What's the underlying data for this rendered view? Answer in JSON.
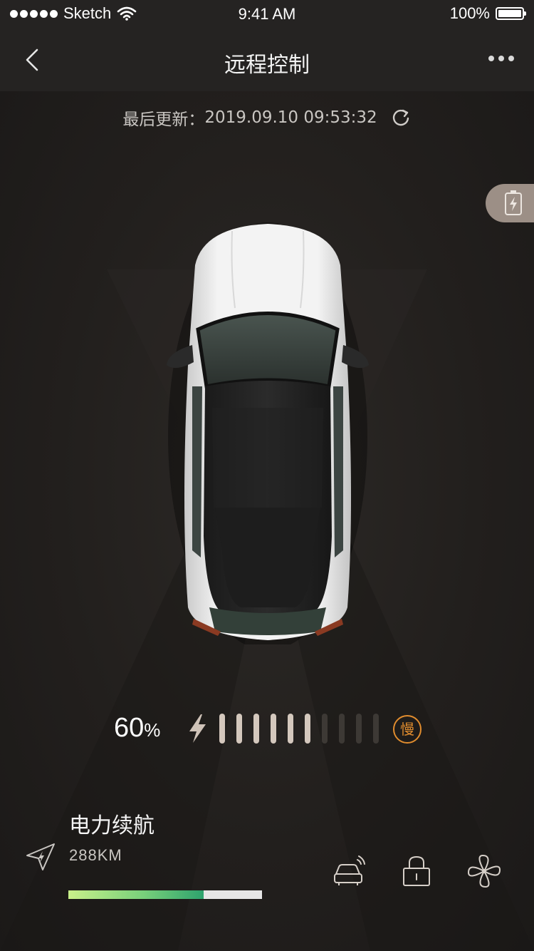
{
  "status_bar": {
    "carrier": "Sketch",
    "time": "9:41 AM",
    "battery": "100%"
  },
  "nav": {
    "title": "远程控制"
  },
  "update": {
    "label": "最后更新：",
    "timestamp": "2019.09.10 09:53:32"
  },
  "charge": {
    "percent": "60",
    "percent_unit": "%",
    "level_fraction": 0.6,
    "segments_total": 10,
    "segments_filled": 6,
    "mode_label": "慢",
    "colors": {
      "filled": "#d4c8bd",
      "empty": "#3d3935",
      "mode": "#e08c2e"
    }
  },
  "range": {
    "title": "电力续航",
    "value": "288KM",
    "level_fraction": 0.7
  },
  "icons": {
    "back": "chevron-left-icon",
    "more": "more-dots-icon",
    "refresh": "refresh-icon",
    "charge_tab": "battery-charging-icon",
    "bolt": "lightning-icon",
    "range": "navigation-arrow-icon",
    "remote_car": "remote-car-icon",
    "lock": "lock-icon",
    "fan": "fan-icon"
  }
}
